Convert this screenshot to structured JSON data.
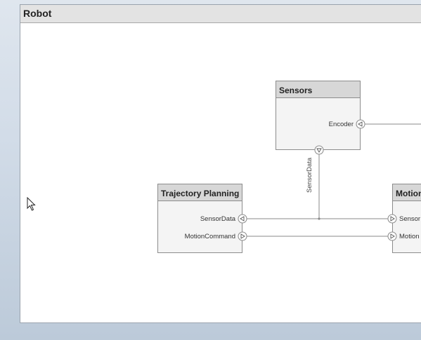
{
  "window": {
    "title": "Robot"
  },
  "blocks": {
    "sensors": {
      "title": "Sensors",
      "port_encoder": "Encoder"
    },
    "trajectory": {
      "title": "Trajectory Planning",
      "port_sensor_data": "SensorData",
      "port_motion_command": "MotionCommand"
    },
    "motion": {
      "title": "Motion",
      "port_sensor": "Sensor",
      "port_motion": "Motion"
    }
  },
  "connections": {
    "sensor_data_label": "SensorData"
  },
  "colors": {
    "wire": "#8a8a8a",
    "block_fill": "#f4f4f4",
    "header_fill": "#d7d7d7"
  }
}
